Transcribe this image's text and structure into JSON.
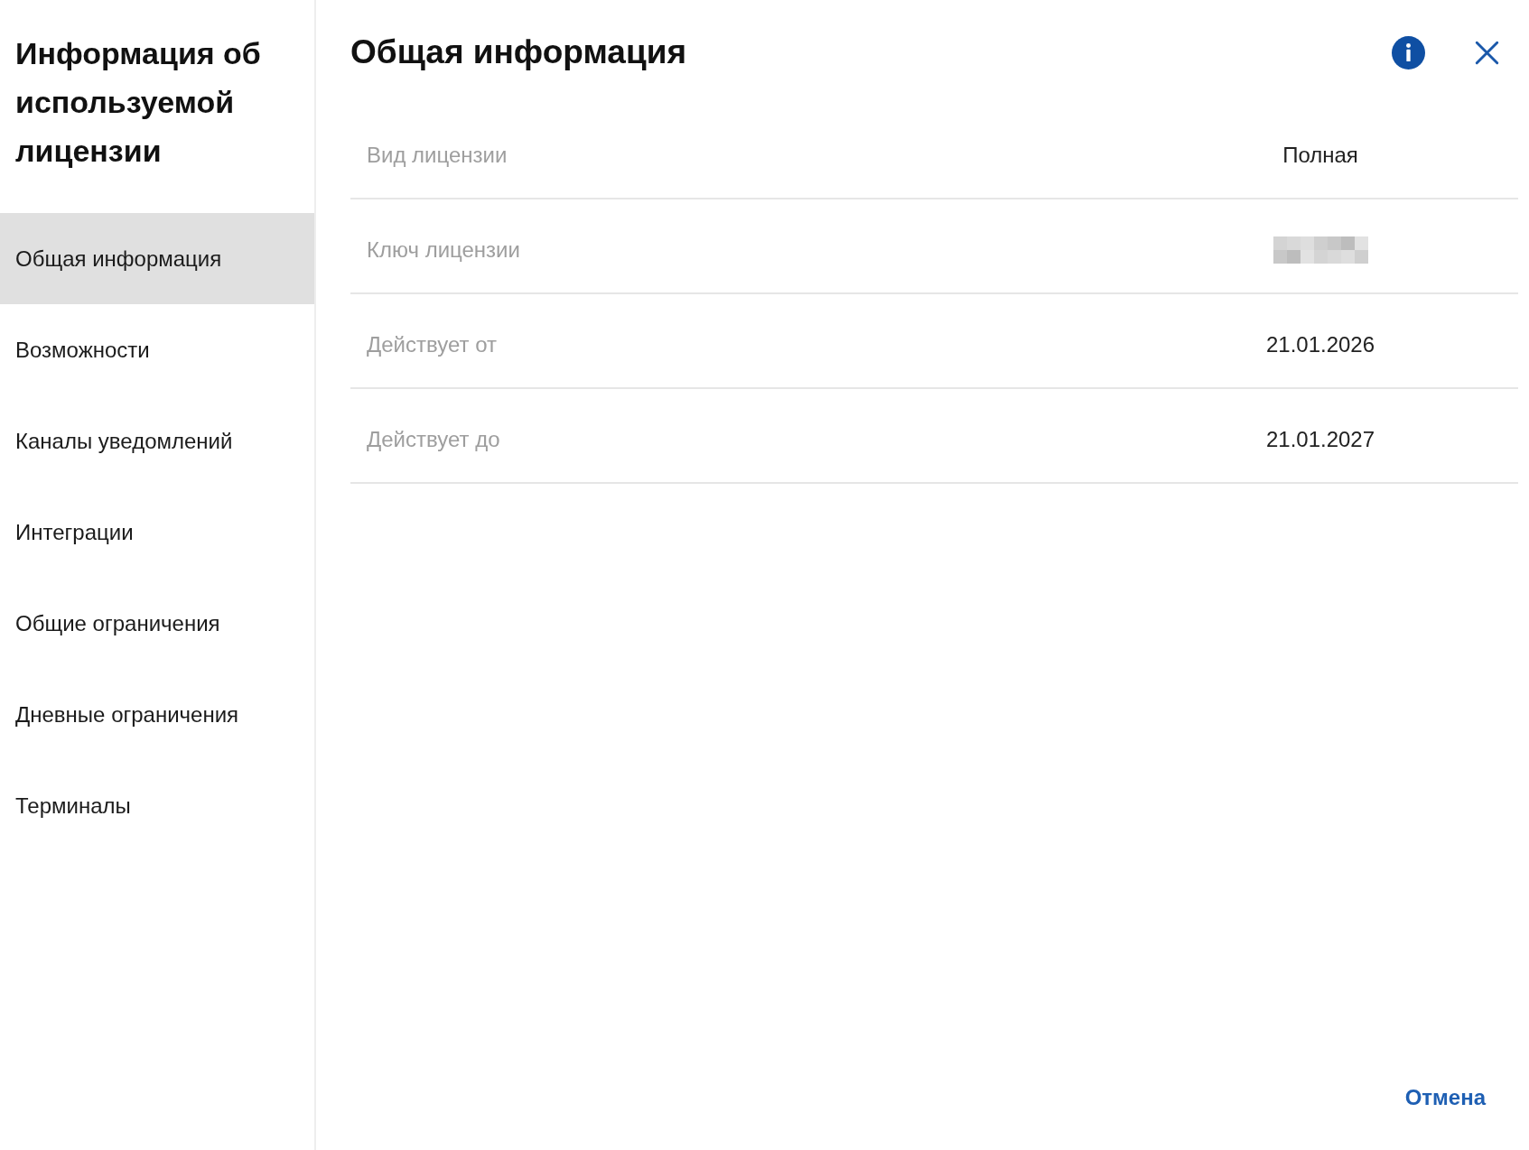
{
  "sidebar": {
    "title": "Информация об используемой лицензии",
    "items": [
      {
        "label": "Общая информация",
        "selected": true
      },
      {
        "label": "Возможности",
        "selected": false
      },
      {
        "label": "Каналы уведомлений",
        "selected": false
      },
      {
        "label": "Интеграции",
        "selected": false
      },
      {
        "label": "Общие ограничения",
        "selected": false
      },
      {
        "label": "Дневные ограничения",
        "selected": false
      },
      {
        "label": "Терминалы",
        "selected": false
      }
    ]
  },
  "main": {
    "title": "Общая информация",
    "rows": [
      {
        "kind": "text",
        "label": "Вид лицензии",
        "value": "Полная"
      },
      {
        "kind": "redacted",
        "label": "Ключ лицензии"
      },
      {
        "kind": "text",
        "label": "Действует от",
        "value": "21.01.2026"
      },
      {
        "kind": "text",
        "label": "Действует до",
        "value": "21.01.2027"
      }
    ]
  },
  "footer": {
    "cancel_button": "Отмена"
  }
}
